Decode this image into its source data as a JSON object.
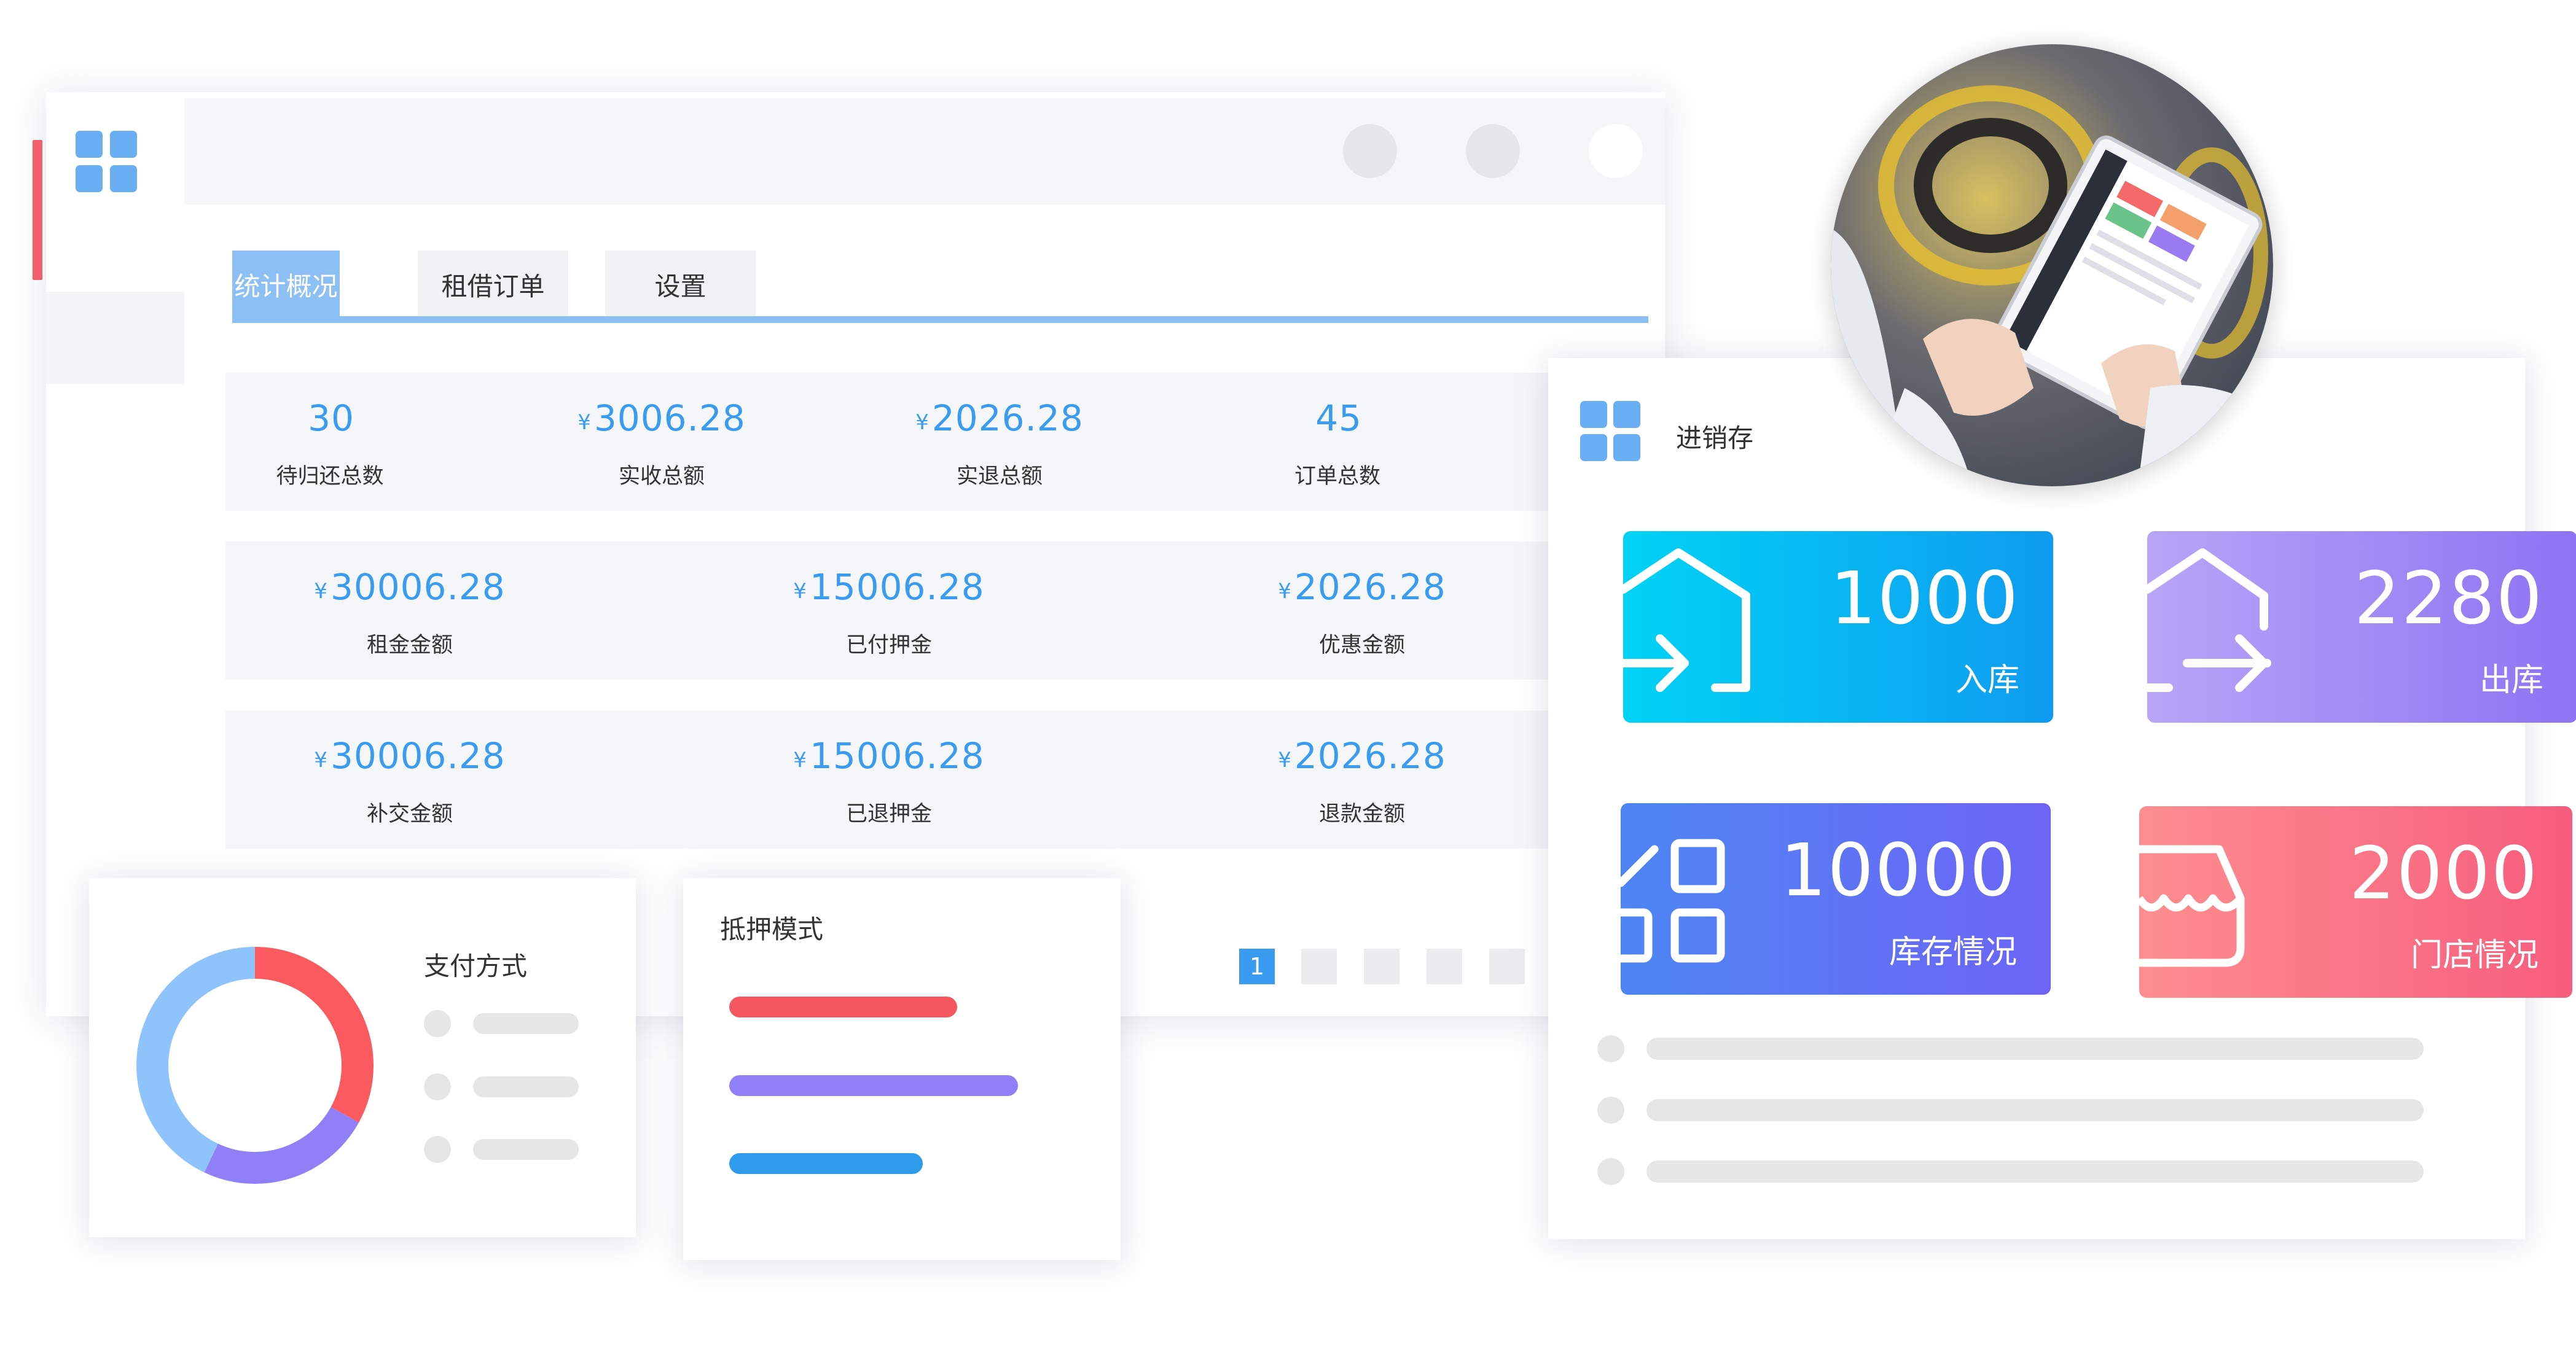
{
  "main_window": {
    "tabs": [
      {
        "label": "统计概况",
        "active": true
      },
      {
        "label": "租借订单",
        "active": false
      },
      {
        "label": "设置",
        "active": false
      }
    ],
    "stats_row1": [
      {
        "value": "30",
        "currency": "",
        "label": "待归还总数"
      },
      {
        "value": "3006.28",
        "currency": "¥",
        "label": "实收总额"
      },
      {
        "value": "2026.28",
        "currency": "¥",
        "label": "实退总额"
      },
      {
        "value": "45",
        "currency": "",
        "label": "订单总数"
      }
    ],
    "stats_row2": [
      {
        "value": "30006.28",
        "currency": "¥",
        "label": "租金金额"
      },
      {
        "value": "15006.28",
        "currency": "¥",
        "label": "已付押金"
      },
      {
        "value": "2026.28",
        "currency": "¥",
        "label": "优惠金额"
      }
    ],
    "stats_row3": [
      {
        "value": "30006.28",
        "currency": "¥",
        "label": "补交金额"
      },
      {
        "value": "15006.28",
        "currency": "¥",
        "label": "已退押金"
      },
      {
        "value": "2026.28",
        "currency": "¥",
        "label": "退款金额"
      }
    ],
    "pagination": {
      "current_page": "1"
    }
  },
  "payment_card": {
    "title": "支付方式",
    "donut_segments": [
      {
        "fraction": 0.33,
        "color": "#fb5a5f"
      },
      {
        "fraction": 0.24,
        "color": "#8f80f8"
      },
      {
        "fraction": 0.43,
        "color": "#8ec3fb"
      }
    ]
  },
  "deposit_card": {
    "title": "抵押模式",
    "bars": [
      {
        "fraction": 0.79,
        "color": "#f4585e"
      },
      {
        "fraction": 1.0,
        "color": "#8f80f8"
      },
      {
        "fraction": 0.67,
        "color": "#2f9ceb"
      }
    ]
  },
  "inventory_card": {
    "title": "进销存",
    "tiles": [
      {
        "value": "1000",
        "label": "入库",
        "icon": "warehouse-in-icon",
        "colors": [
          "#00d3f5",
          "#0f9bf0"
        ]
      },
      {
        "value": "2280",
        "label": "出库",
        "icon": "warehouse-out-icon",
        "colors": [
          "#b7a5f6",
          "#8c74f4"
        ]
      },
      {
        "value": "10000",
        "label": "库存情况",
        "icon": "stock-grid-icon",
        "colors": [
          "#4d86f3",
          "#6e64f6"
        ]
      },
      {
        "value": "2000",
        "label": "门店情况",
        "icon": "store-icon",
        "colors": [
          "#fd8e8f",
          "#f75d7e"
        ]
      }
    ]
  },
  "colors": {
    "accent": "#3a9cf0",
    "tab_active": "#8cc0f5",
    "sidebar_marker": "#f0616b"
  }
}
